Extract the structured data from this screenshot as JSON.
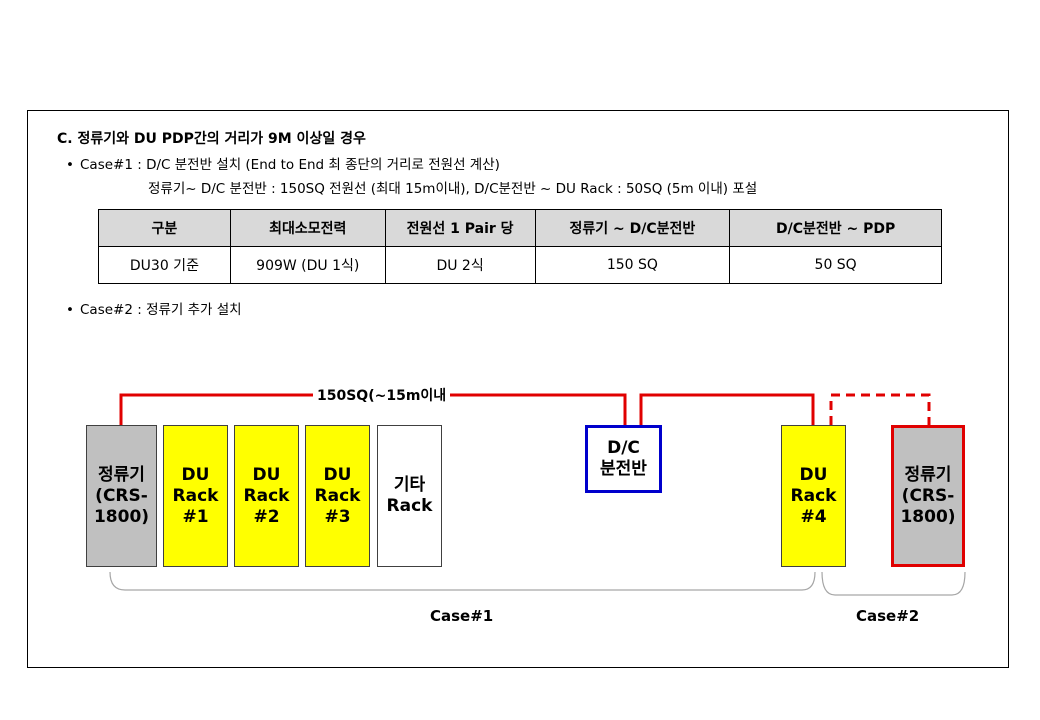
{
  "heading": "C. 정류기와 DU PDP간의 거리가 9M 이상일 경우",
  "case1": {
    "bullet": "•",
    "line1": "Case#1 : D/C 분전반 설치 (End to End 최 종단의 거리로 전원선 계산)",
    "line2": "정류기~ D/C 분전반 : 150SQ 전원선 (최대 15m이내), D/C분전반 ~ DU Rack : 50SQ (5m 이내) 포설"
  },
  "table": {
    "headers": [
      "구분",
      "최대소모전력",
      "전원선 1 Pair 당",
      "정류기 ~ D/C분전반",
      "D/C분전반 ~ PDP"
    ],
    "row": [
      "DU30 기준",
      "909W (DU 1식)",
      "DU 2식",
      "150 SQ",
      "50 SQ"
    ]
  },
  "case2": {
    "bullet": "•",
    "line1": "Case#2 : 정류기 추가 설치"
  },
  "diagram": {
    "wire_label": "150SQ(~15m이내",
    "rectifier_left": [
      "정류기",
      "(CRS-",
      "1800)"
    ],
    "du1": [
      "DU",
      "Rack",
      "#1"
    ],
    "du2": [
      "DU",
      "Rack",
      "#2"
    ],
    "du3": [
      "DU",
      "Rack",
      "#3"
    ],
    "other": [
      "기타",
      "Rack"
    ],
    "dc_panel": [
      "D/C",
      "분전반"
    ],
    "du4": [
      "DU",
      "Rack",
      "#4"
    ],
    "rectifier_right": [
      "정류기",
      "(CRS-",
      "1800)"
    ],
    "case1_label": "Case#1",
    "case2_label": "Case#2",
    "colors": {
      "wire": "#e00000",
      "dc_border": "#0000cc",
      "rack_yellow": "#ffff00",
      "rectifier_gray": "#c0c0c0",
      "brace": "#a6a6a6"
    }
  }
}
